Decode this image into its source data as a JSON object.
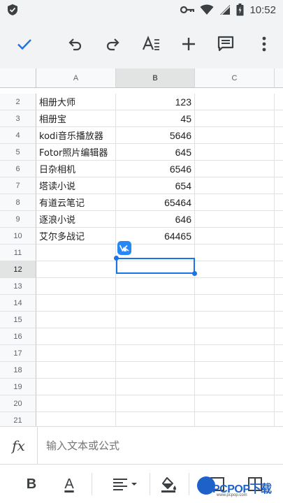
{
  "status_bar": {
    "time": "10:52",
    "icons": [
      "shield-icon",
      "key-icon",
      "wifi-icon",
      "signal-icon",
      "battery-icon"
    ]
  },
  "toolbar": {
    "buttons": [
      "check-icon",
      "undo-icon",
      "redo-icon",
      "text-format-icon",
      "add-icon",
      "comment-icon",
      "more-icon"
    ]
  },
  "sheet": {
    "columns": [
      "A",
      "B",
      "C"
    ],
    "selected_column": "B",
    "selected_row": "12",
    "rows": [
      {
        "num": "2",
        "a": "相册大师",
        "b": "123"
      },
      {
        "num": "3",
        "a": "相册宝",
        "b": "45"
      },
      {
        "num": "4",
        "a": "kodi音乐播放器",
        "b": "5646"
      },
      {
        "num": "5",
        "a": "Fotor照片编辑器",
        "b": "645"
      },
      {
        "num": "6",
        "a": "日杂相机",
        "b": "6546"
      },
      {
        "num": "7",
        "a": "塔读小说",
        "b": "654"
      },
      {
        "num": "8",
        "a": "有道云笔记",
        "b": "65464"
      },
      {
        "num": "9",
        "a": "逐浪小说",
        "b": "646"
      },
      {
        "num": "10",
        "a": "艾尔多战记",
        "b": "64465"
      },
      {
        "num": "11",
        "a": "",
        "b": ""
      },
      {
        "num": "12",
        "a": "",
        "b": ""
      },
      {
        "num": "13",
        "a": "",
        "b": ""
      },
      {
        "num": "14",
        "a": "",
        "b": ""
      },
      {
        "num": "15",
        "a": "",
        "b": ""
      },
      {
        "num": "16",
        "a": "",
        "b": ""
      },
      {
        "num": "17",
        "a": "",
        "b": ""
      },
      {
        "num": "18",
        "a": "",
        "b": ""
      },
      {
        "num": "19",
        "a": "",
        "b": ""
      },
      {
        "num": "20",
        "a": "",
        "b": ""
      },
      {
        "num": "21",
        "a": "",
        "b": ""
      }
    ]
  },
  "formula_bar": {
    "fx_label": "fx",
    "placeholder": "输入文本或公式"
  },
  "format_bar": {
    "bold_label": "B",
    "text_color_label": "A"
  },
  "watermark": {
    "text": "PCPOP下载",
    "sub": "www.pcpop.com"
  },
  "colors": {
    "accent": "#1a73e8",
    "toolbar_bg": "#f1f3f4",
    "header_bg": "#f8f9fa",
    "vk_badge": "#2787f5"
  }
}
